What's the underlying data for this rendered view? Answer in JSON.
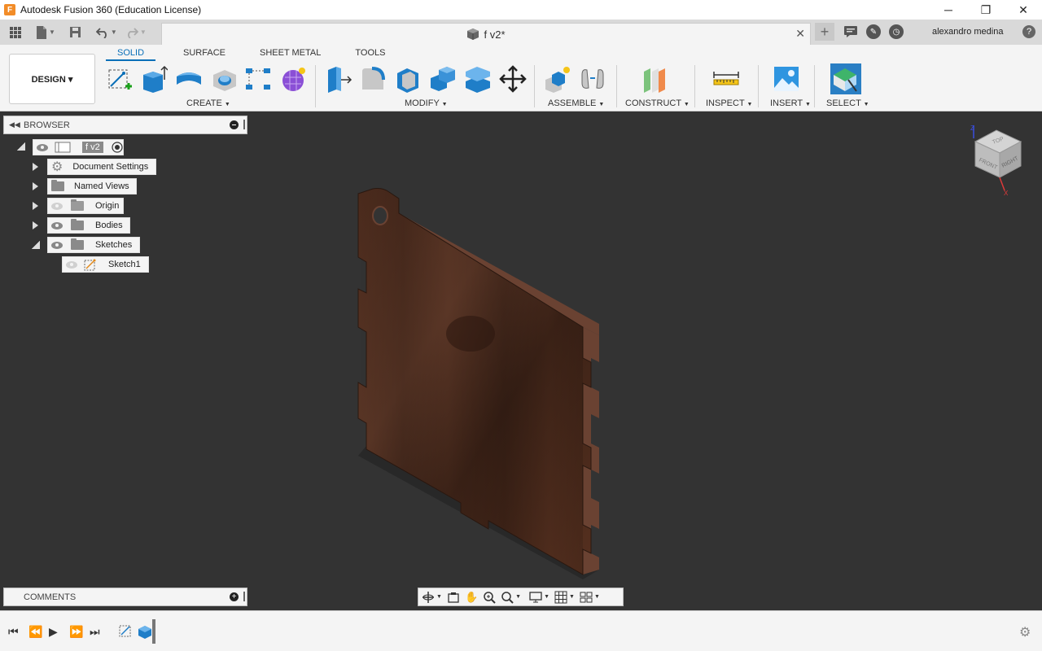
{
  "window": {
    "title": "Autodesk Fusion 360 (Education License)",
    "logo_letter": "F",
    "minimize": "─",
    "maximize": "❐",
    "close": "✕"
  },
  "document": {
    "tab_name": "f v2*",
    "close": "✕",
    "add": "+"
  },
  "user": {
    "name": "alexandro medina",
    "help": "?"
  },
  "workspace": {
    "mode_label": "DESIGN ▾"
  },
  "ribbon_tabs": [
    {
      "label": "SOLID",
      "active": true
    },
    {
      "label": "SURFACE",
      "active": false
    },
    {
      "label": "SHEET METAL",
      "active": false
    },
    {
      "label": "TOOLS",
      "active": false
    }
  ],
  "ribbon_groups": {
    "create": "CREATE",
    "modify": "MODIFY",
    "assemble": "ASSEMBLE",
    "construct": "CONSTRUCT",
    "inspect": "INSPECT",
    "insert": "INSERT",
    "select": "SELECT"
  },
  "browser": {
    "title": "BROWSER",
    "root": "f v2",
    "items": [
      {
        "label": "Document Settings"
      },
      {
        "label": "Named Views"
      },
      {
        "label": "Origin"
      },
      {
        "label": "Bodies"
      },
      {
        "label": "Sketches"
      },
      {
        "label": "Sketch1"
      }
    ]
  },
  "comments": {
    "title": "COMMENTS"
  },
  "viewcube": {
    "top": "TOP",
    "front": "FRONT",
    "right": "RIGHT",
    "z": "Z",
    "x": "X"
  },
  "colors": {
    "accent": "#0a6fb8",
    "canvas": "#333333",
    "wood_dark": "#3e2418",
    "wood_mid": "#5a3626",
    "toolbar_bg": "#f4f4f4"
  }
}
